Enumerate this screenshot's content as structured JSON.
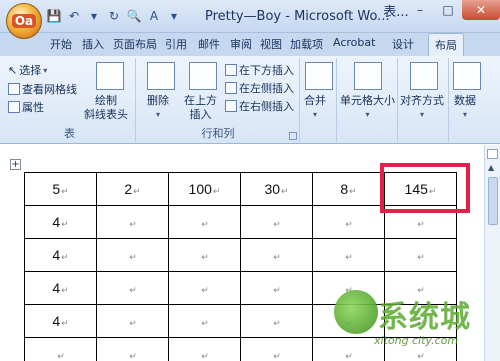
{
  "title_bar": {
    "office_button": "Oa",
    "window_title": "Pretty—Boy - Microsoft Wo...",
    "partial_title": "表..."
  },
  "tabs": [
    {
      "label": "开始"
    },
    {
      "label": "插入"
    },
    {
      "label": "页面布局"
    },
    {
      "label": "引用"
    },
    {
      "label": "邮件"
    },
    {
      "label": "审阅"
    },
    {
      "label": "视图"
    },
    {
      "label": "加载项"
    },
    {
      "label": "Acrobat"
    },
    {
      "label": "设计"
    },
    {
      "label": "布局",
      "active": true
    }
  ],
  "ribbon": {
    "table_group": {
      "label": "表",
      "select": "选择",
      "view_gridlines": "查看网格线",
      "properties": "属性",
      "draw_diagonal_line1": "绘制",
      "draw_diagonal_line2": "斜线表头"
    },
    "rows_cols_group": {
      "label": "行和列",
      "delete": "删除",
      "insert_above1": "在上方",
      "insert_above2": "插入",
      "insert_below": "在下方插入",
      "insert_left": "在左侧插入",
      "insert_right": "在右侧插入"
    },
    "merge": "合并",
    "cell_size": "单元格大小",
    "alignment": "对齐方式",
    "data": "数据"
  },
  "table": {
    "rows": [
      [
        "5",
        "2",
        "100",
        "30",
        "8",
        "145"
      ],
      [
        "4",
        "",
        "",
        "",
        "",
        ""
      ],
      [
        "4",
        "",
        "",
        "",
        "",
        ""
      ],
      [
        "4",
        "",
        "",
        "",
        "",
        ""
      ],
      [
        "4",
        "",
        "",
        "",
        "",
        ""
      ],
      [
        "",
        "",
        "",
        "",
        "",
        ""
      ]
    ],
    "cell_mark": "↵"
  },
  "watermark": {
    "text": "系统城",
    "sub": "xitong city.com"
  },
  "colors": {
    "highlight_box": "#e2204a",
    "ribbon_bg": "#dbe7f7",
    "watermark_green": "#5aaa2e"
  }
}
